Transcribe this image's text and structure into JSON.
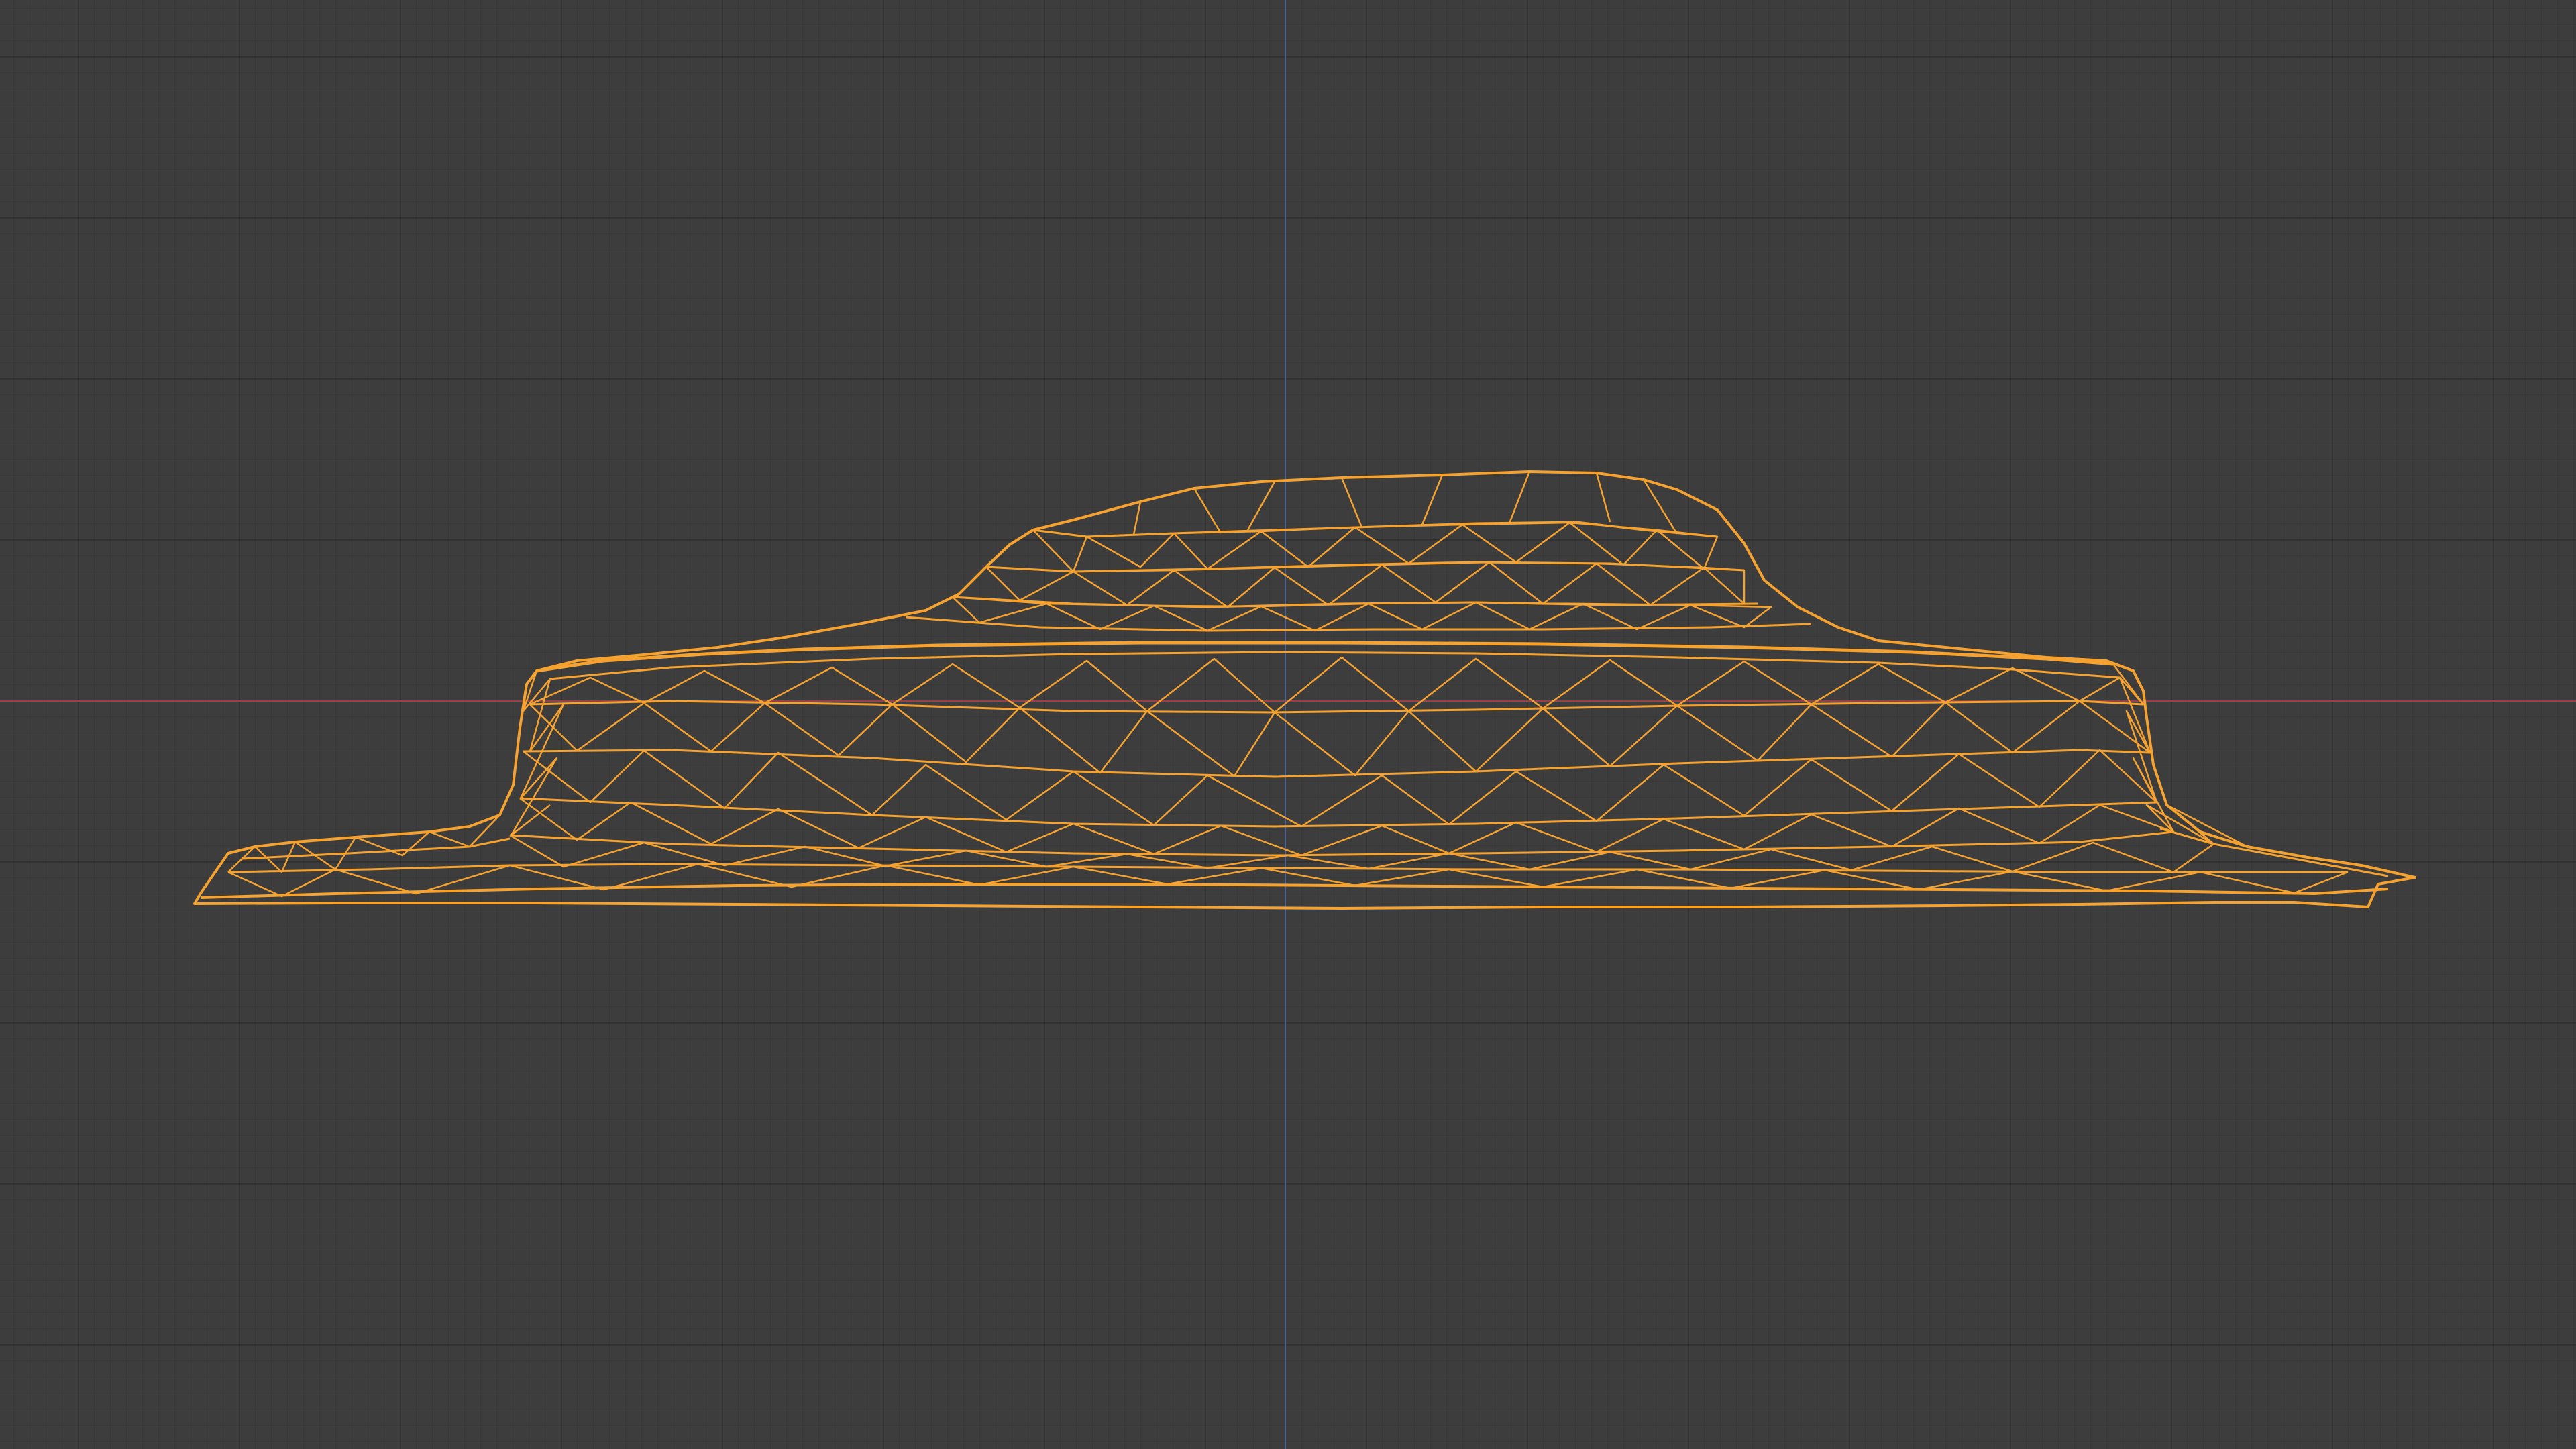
{
  "viewport": {
    "background_color": "#3d3d3d",
    "grid_color": "#343434"
  },
  "axes": {
    "x_axis_color": "#9b3f45",
    "z_axis_color": "#4a6392"
  },
  "object": {
    "kind": "mesh",
    "display": "wireframe",
    "selected": true,
    "wire_color": "#f5a230"
  }
}
